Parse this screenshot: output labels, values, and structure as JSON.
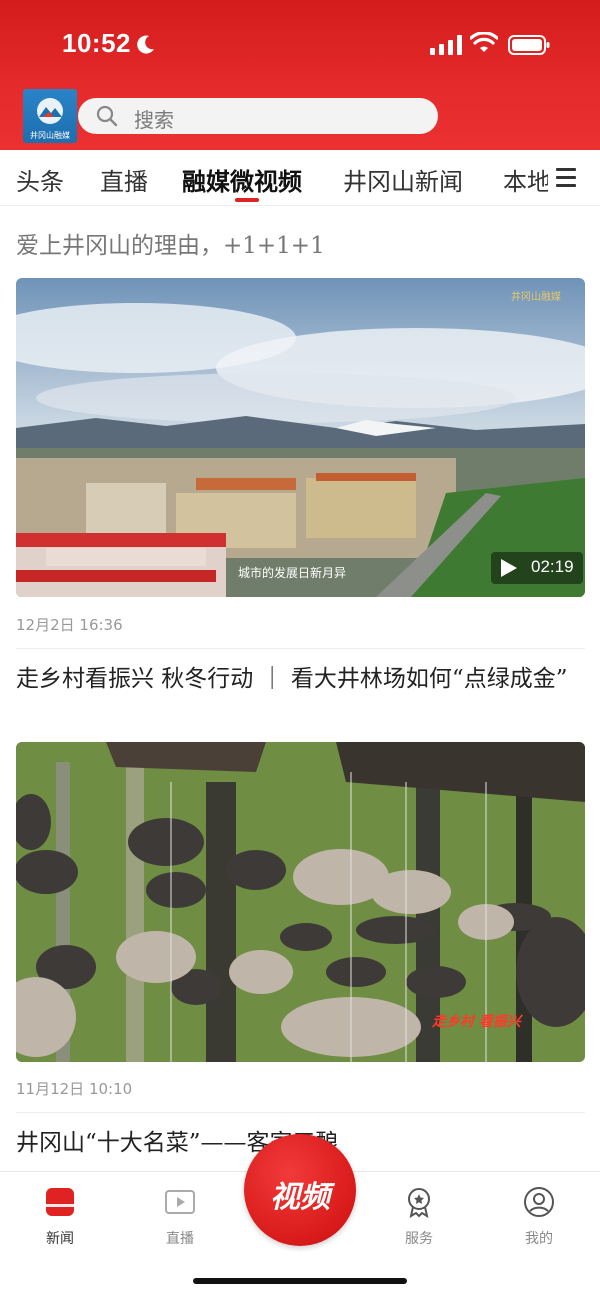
{
  "status_bar": {
    "time": "10:52"
  },
  "header": {
    "logo_label": "井冈山融媒",
    "search_placeholder": "搜索"
  },
  "tabs": [
    {
      "label": "头条"
    },
    {
      "label": "直播"
    },
    {
      "label": "融媒微视频",
      "active": true
    },
    {
      "label": "井冈山新闻"
    },
    {
      "label": "本地"
    }
  ],
  "feed": [
    {
      "title": "爱上井冈山的理由，+1+1+1",
      "duration": "02:19",
      "overlay_caption": "城市的发展日新月异",
      "watermark": "井冈山融媒",
      "date": "12月2日  16:36"
    },
    {
      "title": "走乡村看振兴 秋冬行动 ｜ 看大井林场如何“点绿成金”",
      "overlay_caption": "走乡村 看振兴",
      "date": "11月12日  10:10"
    },
    {
      "title": "井冈山“十大名菜”——客家三酿"
    }
  ],
  "bottom_nav": {
    "items": [
      {
        "label": "新闻",
        "icon": "news-icon",
        "active": true
      },
      {
        "label": "直播",
        "icon": "live-icon"
      },
      {
        "label": "服务",
        "icon": "service-icon"
      },
      {
        "label": "我的",
        "icon": "profile-icon"
      }
    ],
    "center_button": "视频"
  },
  "colors": {
    "brand_red": "#e02222",
    "header_red": "#d41c1c"
  }
}
